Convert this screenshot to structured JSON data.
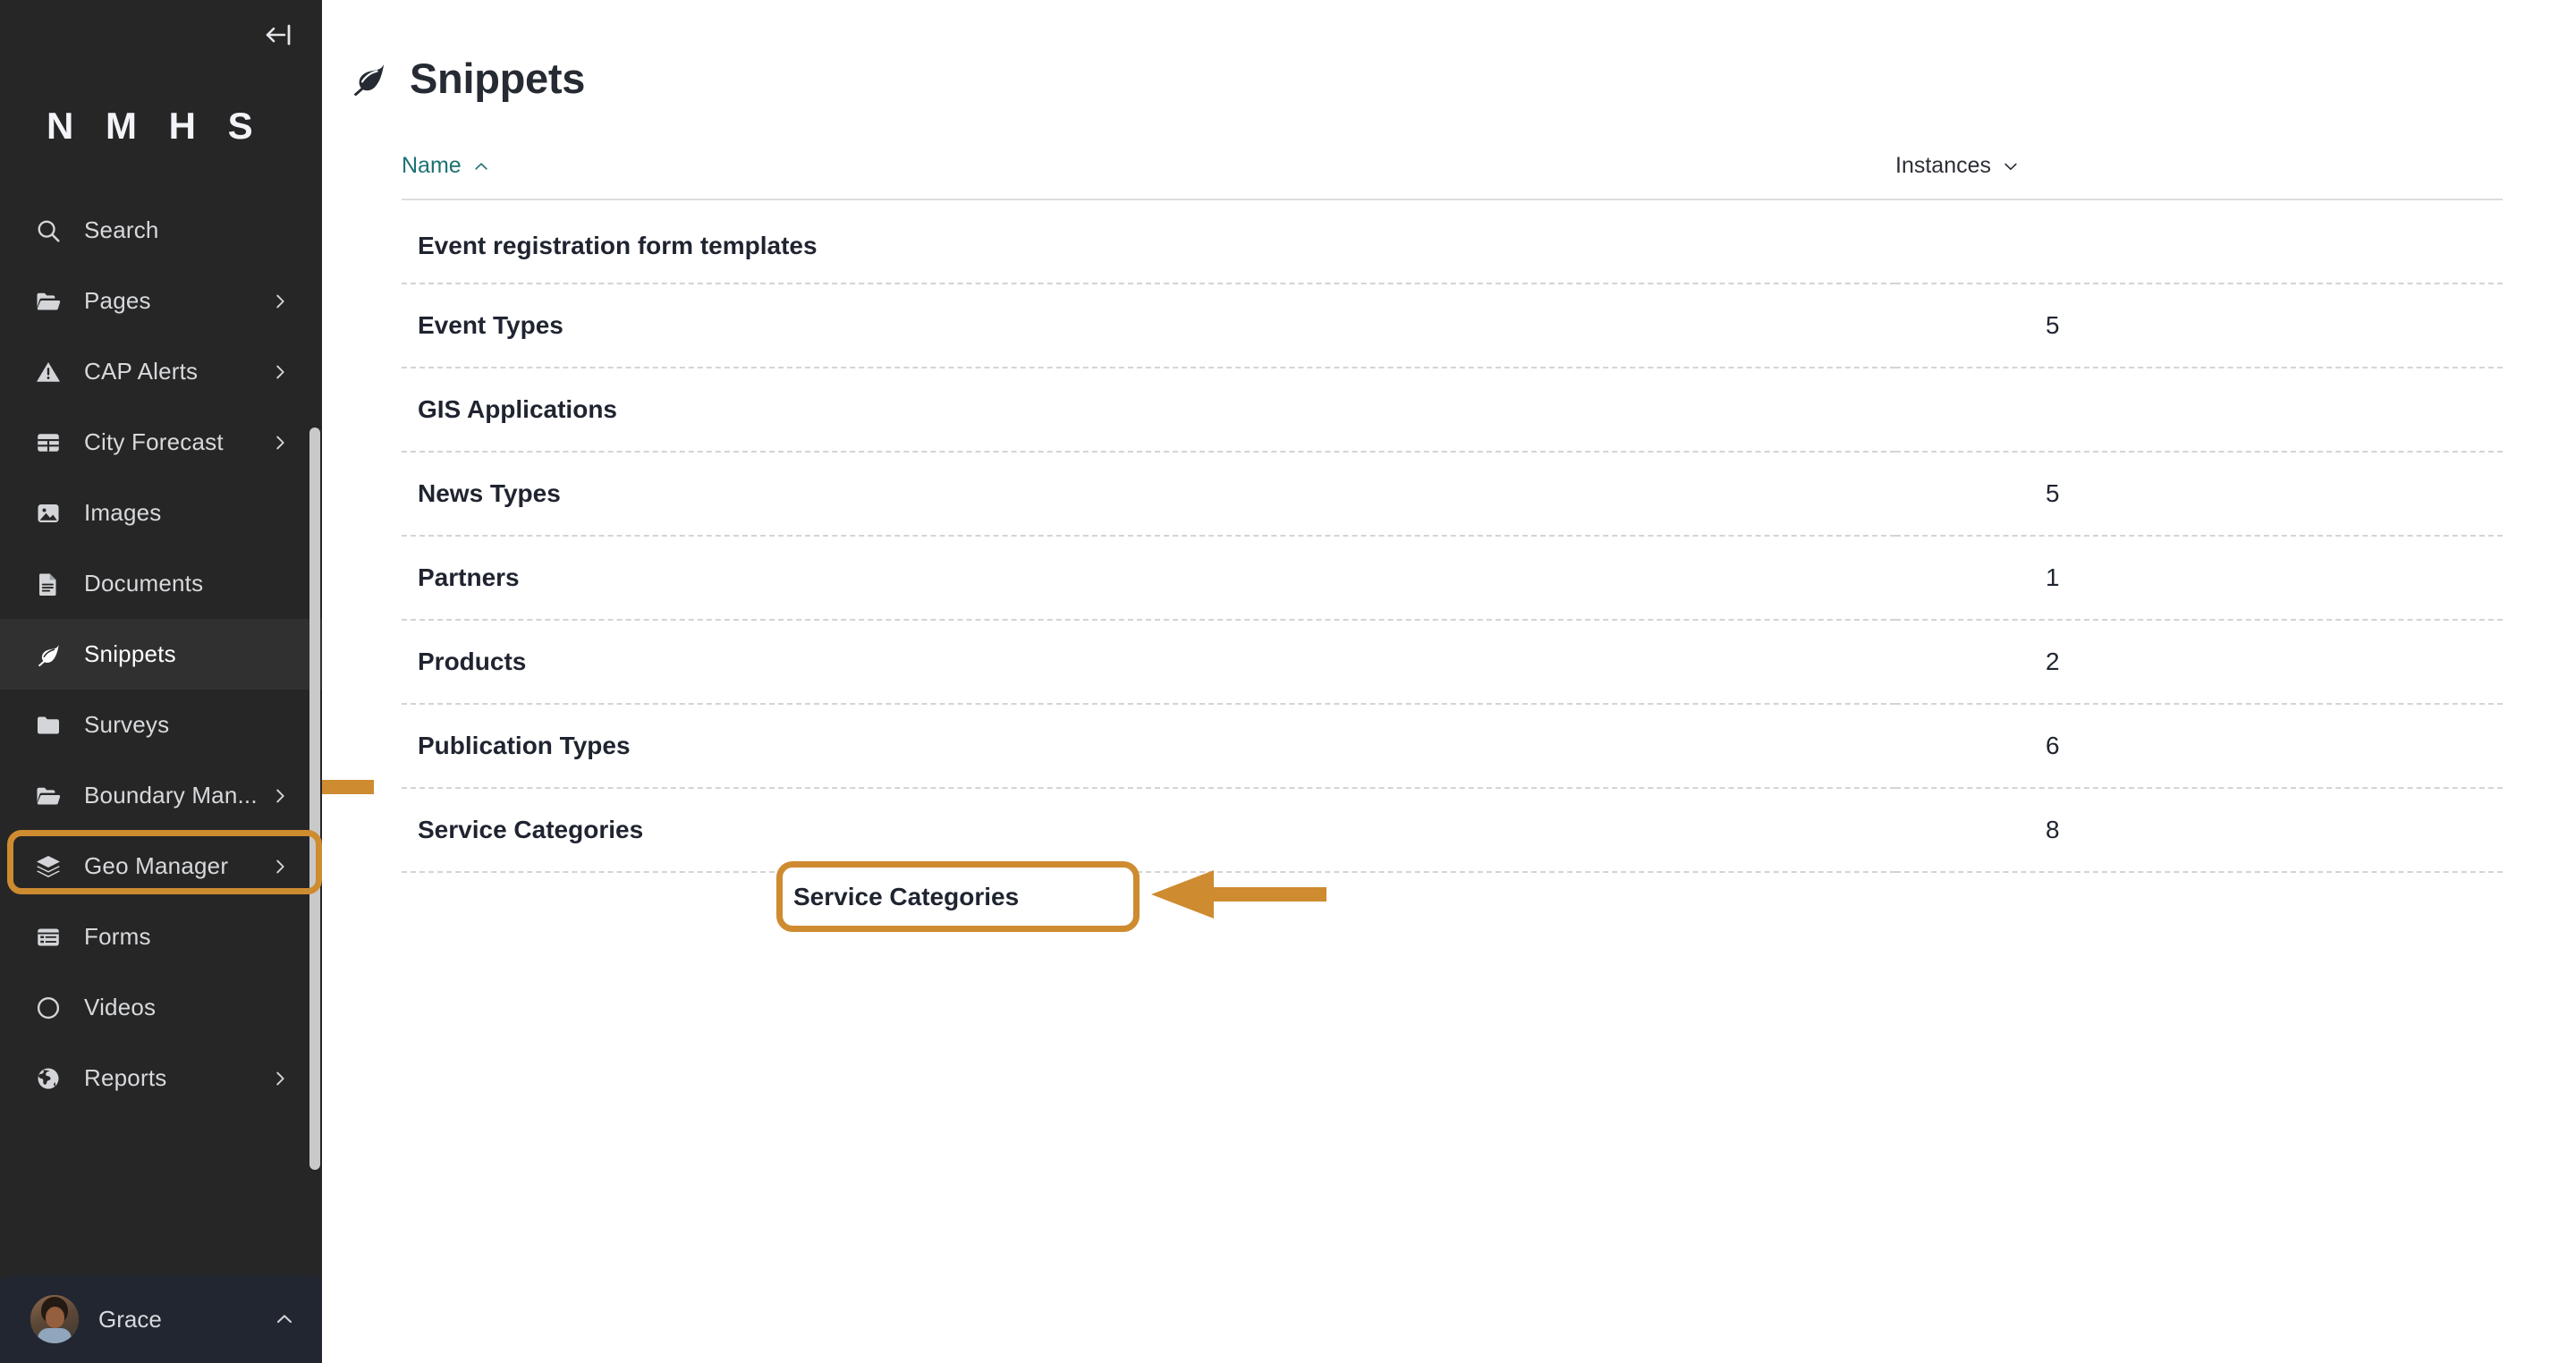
{
  "sidebar": {
    "collapse_icon": "collapse-sidebar-icon",
    "brand": "N M H S",
    "items": [
      {
        "label": "Search",
        "icon": "search-icon",
        "chevron": false,
        "active": false
      },
      {
        "label": "Pages",
        "icon": "folder-open-icon",
        "chevron": true,
        "active": false
      },
      {
        "label": "CAP Alerts",
        "icon": "warning-icon",
        "chevron": true,
        "active": false
      },
      {
        "label": "City Forecast",
        "icon": "table-icon",
        "chevron": true,
        "active": false
      },
      {
        "label": "Images",
        "icon": "image-icon",
        "chevron": false,
        "active": false
      },
      {
        "label": "Documents",
        "icon": "document-icon",
        "chevron": false,
        "active": false
      },
      {
        "label": "Snippets",
        "icon": "leaf-icon",
        "chevron": false,
        "active": true
      },
      {
        "label": "Surveys",
        "icon": "folder-icon",
        "chevron": false,
        "active": false
      },
      {
        "label": "Boundary Man...",
        "icon": "folder-open-icon",
        "chevron": true,
        "active": false
      },
      {
        "label": "Geo Manager",
        "icon": "layers-icon",
        "chevron": true,
        "active": false
      },
      {
        "label": "Forms",
        "icon": "form-list-icon",
        "chevron": false,
        "active": false
      },
      {
        "label": "Videos",
        "icon": "circle-icon",
        "chevron": false,
        "active": false
      },
      {
        "label": "Reports",
        "icon": "globe-icon",
        "chevron": true,
        "active": false
      }
    ],
    "user": {
      "name": "Grace",
      "avatar": "user-avatar",
      "caret": "chevron-up-icon"
    }
  },
  "main": {
    "title": "Snippets",
    "title_icon": "leaf-icon",
    "table": {
      "columns": [
        {
          "label": "Name",
          "sort": "asc",
          "caret": "chevron-up-icon",
          "accent": "#1d7273"
        },
        {
          "label": "Instances",
          "sort": "desc",
          "caret": "chevron-down-icon",
          "accent": "#2c2f36"
        }
      ],
      "rows": [
        {
          "name": "Event registration form templates",
          "instances": ""
        },
        {
          "name": "Event Types",
          "instances": "5"
        },
        {
          "name": "GIS Applications",
          "instances": ""
        },
        {
          "name": "News Types",
          "instances": "5"
        },
        {
          "name": "Partners",
          "instances": "1"
        },
        {
          "name": "Products",
          "instances": "2"
        },
        {
          "name": "Publication Types",
          "instances": "6"
        },
        {
          "name": "Service Categories",
          "instances": "8"
        }
      ]
    }
  },
  "annotations": {
    "accent_color": "#ce8b30",
    "highlight_sidebar_target": "Snippets",
    "highlight_row_target": "Service Categories",
    "arrows": [
      {
        "name": "arrow-to-snippets-nav",
        "direction": "left"
      },
      {
        "name": "arrow-to-service-categories-row",
        "direction": "left"
      }
    ]
  }
}
